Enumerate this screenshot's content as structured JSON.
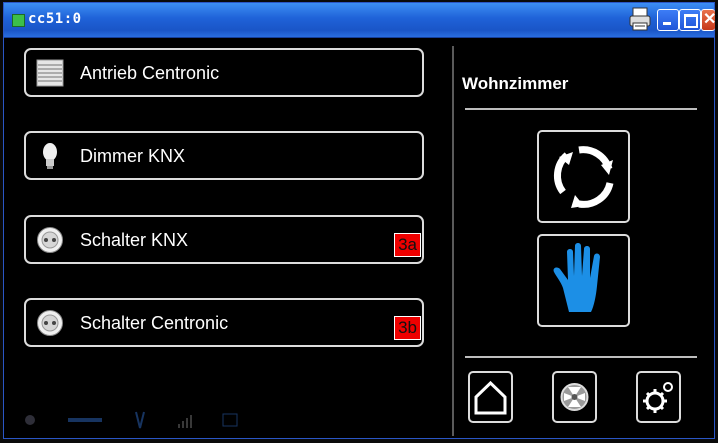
{
  "window": {
    "title": "cc51:0"
  },
  "devices": [
    {
      "label": "Antrieb Centronic",
      "icon": "blind-icon"
    },
    {
      "label": "Dimmer KNX",
      "icon": "bulb-icon"
    },
    {
      "label": "Schalter KNX",
      "icon": "socket-icon",
      "badge": "3a"
    },
    {
      "label": "Schalter Centronic",
      "icon": "socket-icon",
      "badge": "3b"
    }
  ],
  "room": {
    "name": "Wohnzimmer"
  },
  "colors": {
    "accent": "#1c8fe6",
    "badge": "#ee0000",
    "titlebar": "#1f62d8"
  }
}
